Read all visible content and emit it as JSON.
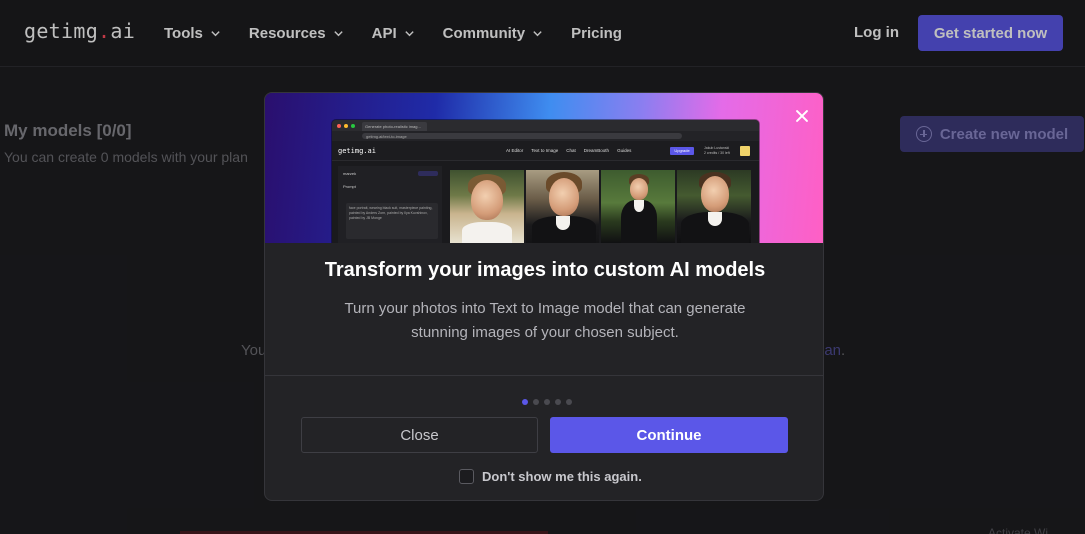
{
  "navbar": {
    "logo_main": "getimg",
    "logo_dot": ".",
    "logo_tld": "ai",
    "links": [
      {
        "label": "Tools",
        "has_dropdown": true
      },
      {
        "label": "Resources",
        "has_dropdown": true
      },
      {
        "label": "API",
        "has_dropdown": true
      },
      {
        "label": "Community",
        "has_dropdown": true
      },
      {
        "label": "Pricing",
        "has_dropdown": false
      }
    ],
    "login": "Log in",
    "cta": "Get started now"
  },
  "background": {
    "title": "My models [0/0]",
    "subtitle": "You can create 0 models with your plan",
    "create_button": "Create new model",
    "body_left": "You",
    "body_right_link": "lan",
    "body_right_tail": ".",
    "bottom_fragment": "Activate Wi"
  },
  "modal": {
    "mini_screenshot": {
      "tab_title": "Generate photo-realistic imag...",
      "url": "getimg.ai/text-to-image",
      "logo": "getimg.ai",
      "nav_links": [
        "AI Editor",
        "Text to Image",
        "Chat",
        "DreamBooth",
        "Guides"
      ],
      "upgrade": "Upgrade",
      "user_name": "Jakub Lustanski",
      "user_credits": "2 credits / 30 left",
      "side_model": "marzek",
      "side_prompt_label": "Prompt",
      "prompt_text": "face portrait, wearing black suit, masterpiece painting, painted by Anders Zorn, painted by Ilya Kuvshinov, painted by JB Monge"
    },
    "title": "Transform your images into custom AI models",
    "description": "Turn your photos into Text to Image model that can generate stunning images of your chosen subject.",
    "pager": {
      "total": 5,
      "active": 0
    },
    "close_button": "Close",
    "continue_button": "Continue",
    "checkbox_label": "Don't show me this again.",
    "checkbox_checked": false
  },
  "colors": {
    "accent": "#5b57e8",
    "background": "#1e1e21",
    "modal": "#232326",
    "logo_dot": "#ff4d5e"
  }
}
